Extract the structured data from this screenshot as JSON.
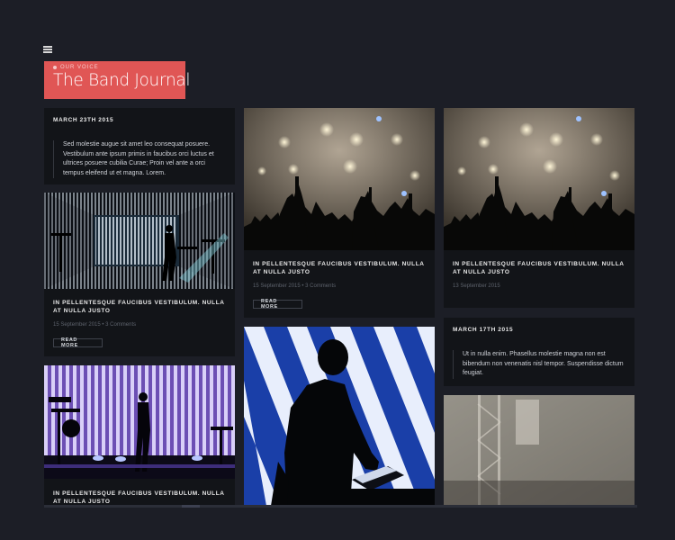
{
  "header": {
    "kicker": "OUR VOICE",
    "title": "The Band Journal"
  },
  "cards": {
    "quote1": {
      "date": "MARCH 23TH 2015",
      "text": "Sed molestie augue sit amet leo consequat posuere. Vestibulum ante ipsum primis in faucibus orci luctus et ultrices posuere cubilia Curae; Proin vel ante a orci tempus eleifend ut et magna. Lorem."
    },
    "post1": {
      "title": "IN PELLENTESQUE FAUCIBUS VESTIBULUM. NULLA AT NULLA JUSTO",
      "meta": "15 September 2015 • 3 Comments",
      "button": "READ MORE"
    },
    "post2": {
      "title": "IN PELLENTESQUE FAUCIBUS VESTIBULUM. NULLA AT NULLA JUSTO",
      "meta": "15 September 2015 • 3 Comments",
      "button": "READ MORE"
    },
    "post3": {
      "title": "IN PELLENTESQUE FAUCIBUS VESTIBULUM. NULLA AT NULLA JUSTO",
      "meta": "13 September 2015"
    },
    "quote2": {
      "date": "MARCH 17TH 2015",
      "text": "Ut in nulla enim. Phasellus molestie magna non est bibendum non venenatis nisl tempor. Suspendisse dictum feugiat."
    },
    "post4": {
      "title": "IN PELLENTESQUE FAUCIBUS VESTIBULUM. NULLA AT NULLA JUSTO"
    }
  },
  "icons": {
    "menu": "hamburger-menu-icon",
    "kicker": "dot-icon"
  },
  "colors": {
    "accent": "#e05655",
    "background": "#1c1e26",
    "card": "#121418"
  }
}
